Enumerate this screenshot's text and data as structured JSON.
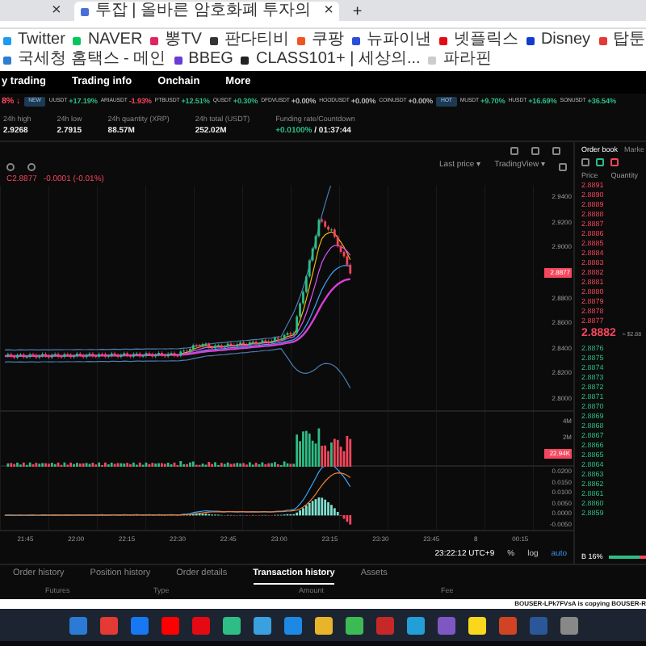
{
  "browser": {
    "tabs": [
      {
        "close": "×",
        "selected": false
      },
      {
        "label": "투잡 | 올바른 암호화폐 투자의",
        "close": "×",
        "selected": true
      }
    ],
    "new_tab": "+",
    "bookmarks": [
      "Twitter",
      "NAVER",
      "뽕TV",
      "판다티비",
      "쿠팡",
      "뉴파이낸",
      "넷플릭스",
      "Disney",
      "탑툰",
      "국세청 홈택스 - 메인",
      "BBEG",
      "CLASS101+ | 세상의...",
      "파라핀"
    ]
  },
  "nav": [
    "y trading",
    "Trading info",
    "Onchain",
    "More"
  ],
  "ticker": [
    {
      "kind": "pair",
      "change": "8% ↓",
      "color": "#f6465d"
    },
    {
      "kind": "tag",
      "symbol": "NEW"
    },
    {
      "kind": "pair",
      "symbol": "UUSDT",
      "change": "+17.19%",
      "color": "#2ebd85"
    },
    {
      "kind": "pair",
      "symbol": "ARIAUSDT",
      "change": "-1.93%",
      "color": "#f6465d"
    },
    {
      "kind": "pair",
      "symbol": "PTBUSDT",
      "change": "+12.51%",
      "color": "#2ebd85"
    },
    {
      "kind": "pair",
      "symbol": "QUSDT",
      "change": "+0.30%",
      "color": "#2ebd85"
    },
    {
      "kind": "pair",
      "symbol": "DFDVUSDT",
      "change": "+0.00%",
      "color": "#bbbbbb"
    },
    {
      "kind": "pair",
      "symbol": "HOODUSDT",
      "change": "+0.00%",
      "color": "#bbbbbb"
    },
    {
      "kind": "pair",
      "symbol": "COINUSDT",
      "change": "+0.00%",
      "color": "#bbbbbb"
    },
    {
      "kind": "tag",
      "symbol": "HOT"
    },
    {
      "kind": "pair",
      "symbol": "MUSDT",
      "change": "+9.70%",
      "color": "#2ebd85"
    },
    {
      "kind": "pair",
      "symbol": "HUSDT",
      "change": "+16.69%",
      "color": "#2ebd85"
    },
    {
      "kind": "pair",
      "symbol": "SONUSDT",
      "change": "+36.54%",
      "color": "#2ebd85"
    }
  ],
  "stats": [
    {
      "label": "24h high",
      "value": "2.9268"
    },
    {
      "label": "24h low",
      "value": "2.7915"
    },
    {
      "label": "24h quantity (XRP)",
      "value": "88.57M"
    },
    {
      "label": "24h total (USDT)",
      "value": "252.02M"
    },
    {
      "label": "Funding rate/Countdown",
      "value": "+0.0100%",
      "extra": "/ 01:37:44"
    }
  ],
  "chart": {
    "price_source": "Last price ▾",
    "chart_type": "TradingView ▾",
    "quote": "C2.8877",
    "quote_change": "-0.0001 (-0.01%)",
    "price_axis": [
      "2.9400",
      "2.9200",
      "2.9000",
      "2.8800",
      "2.8600",
      "2.8400",
      "2.8200",
      "2.8000"
    ],
    "last_price_tag": "2.8877",
    "volume_axis": [
      "4M",
      "2M"
    ],
    "volume_tag": "22.94K",
    "macd_axis": [
      "0.0200",
      "0.0150",
      "0.0100",
      "0.0050",
      "0.0000",
      "-0.0050"
    ],
    "time_axis": [
      "21:45",
      "22:00",
      "22:15",
      "22:30",
      "22:45",
      "23:00",
      "23:15",
      "23:30",
      "23:45",
      "8",
      "00:15"
    ],
    "clock": "23:22:12 UTC+9",
    "scale_options": [
      {
        "label": "%",
        "selected": false
      },
      {
        "label": "log",
        "selected": false
      },
      {
        "label": "auto",
        "selected": true
      }
    ]
  },
  "order_book": {
    "tabs": [
      {
        "label": "Order book",
        "selected": true
      },
      {
        "label": "Marke",
        "selected": false
      }
    ],
    "columns": [
      "Price",
      "Quantity"
    ],
    "asks": [
      "2.8891",
      "2.8890",
      "2.8889",
      "2.8888",
      "2.8887",
      "2.8886",
      "2.8885",
      "2.8884",
      "2.8883",
      "2.8882",
      "2.8881",
      "2.8880",
      "2.8879",
      "2.8878",
      "2.8877"
    ],
    "mid_price": "2.8882",
    "mid_usd": "≈ $2.88",
    "bids": [
      "2.8876",
      "2.8875",
      "2.8874",
      "2.8873",
      "2.8872",
      "2.8871",
      "2.8870",
      "2.8869",
      "2.8868",
      "2.8867",
      "2.8866",
      "2.8865",
      "2.8864",
      "2.8863",
      "2.8862",
      "2.8861",
      "2.8860",
      "2.8859"
    ],
    "ratio": "B 16%",
    "level": 0.84
  },
  "history_tabs": [
    {
      "label": "Order history",
      "selected": false
    },
    {
      "label": "Position history",
      "selected": false
    },
    {
      "label": "Order details",
      "selected": false
    },
    {
      "label": "Transaction history",
      "selected": true
    },
    {
      "label": "Assets",
      "selected": false
    }
  ],
  "history_columns": [
    "Futures",
    "Type",
    "Amount",
    "Fee"
  ],
  "notice": "BOUSER-LPk7FVsA is copying BOUSER-R"
}
